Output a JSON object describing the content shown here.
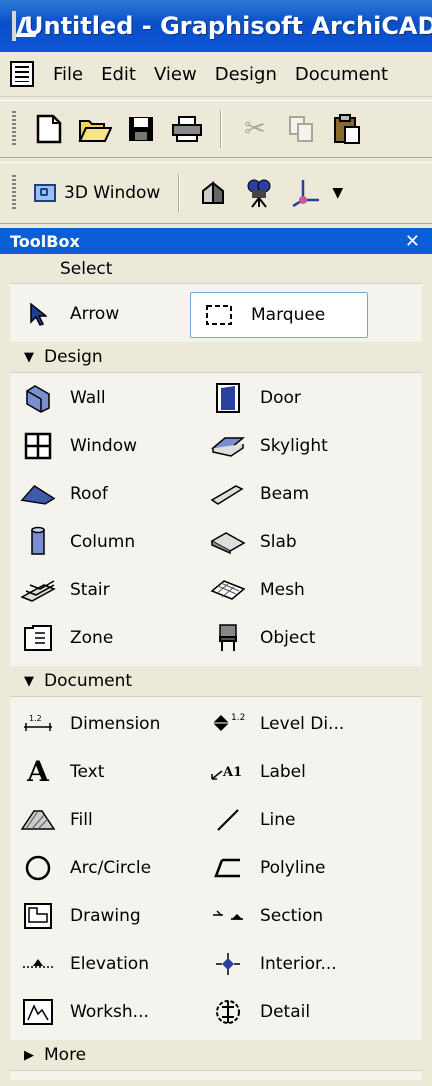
{
  "window": {
    "title": "Untitled - Graphisoft ArchiCAD"
  },
  "menu": [
    "File",
    "Edit",
    "View",
    "Design",
    "Document"
  ],
  "toolbar1": {
    "icons": [
      "new-file-icon",
      "open-folder-icon",
      "save-icon",
      "print-icon",
      "cut-icon",
      "copy-icon",
      "paste-icon"
    ]
  },
  "toolbar2": {
    "window_button": "3D Window",
    "icons": [
      "house-icon",
      "camera-icon",
      "axis-icon"
    ]
  },
  "toolbox": {
    "title": "ToolBox",
    "select_section": "Select",
    "select_tools": [
      {
        "label": "Arrow",
        "icon": "arrow-icon"
      },
      {
        "label": "Marquee",
        "icon": "marquee-icon"
      }
    ],
    "design_section": "Design",
    "design_tools": [
      {
        "label": "Wall",
        "icon": "wall-icon"
      },
      {
        "label": "Door",
        "icon": "door-icon"
      },
      {
        "label": "Window",
        "icon": "window-icon"
      },
      {
        "label": "Skylight",
        "icon": "skylight-icon"
      },
      {
        "label": "Roof",
        "icon": "roof-icon"
      },
      {
        "label": "Beam",
        "icon": "beam-icon"
      },
      {
        "label": "Column",
        "icon": "column-icon"
      },
      {
        "label": "Slab",
        "icon": "slab-icon"
      },
      {
        "label": "Stair",
        "icon": "stair-icon"
      },
      {
        "label": "Mesh",
        "icon": "mesh-icon"
      },
      {
        "label": "Zone",
        "icon": "zone-icon"
      },
      {
        "label": "Object",
        "icon": "object-icon"
      }
    ],
    "document_section": "Document",
    "document_tools": [
      {
        "label": "Dimension",
        "icon": "dimension-icon"
      },
      {
        "label": "Level Di...",
        "icon": "level-dimension-icon"
      },
      {
        "label": "Text",
        "icon": "text-icon"
      },
      {
        "label": "Label",
        "icon": "label-icon"
      },
      {
        "label": "Fill",
        "icon": "fill-icon"
      },
      {
        "label": "Line",
        "icon": "line-icon"
      },
      {
        "label": "Arc/Circle",
        "icon": "arc-circle-icon"
      },
      {
        "label": "Polyline",
        "icon": "polyline-icon"
      },
      {
        "label": "Drawing",
        "icon": "drawing-icon"
      },
      {
        "label": "Section",
        "icon": "section-icon"
      },
      {
        "label": "Elevation",
        "icon": "elevation-icon"
      },
      {
        "label": "Interior...",
        "icon": "interior-icon"
      },
      {
        "label": "Worksh...",
        "icon": "worksheet-icon"
      },
      {
        "label": "Detail",
        "icon": "detail-icon"
      }
    ],
    "more_section": "More"
  }
}
